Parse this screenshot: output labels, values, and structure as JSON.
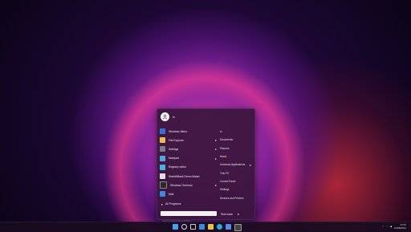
{
  "start_menu": {
    "user_name": "ic",
    "apps": [
      {
        "label": "Windows Menu",
        "icon": "windows-menu-icon",
        "color": "#3a6fd8",
        "submenu": false
      },
      {
        "label": "File Explorer",
        "icon": "file-explorer-icon",
        "color": "#e8c04a",
        "submenu": true
      },
      {
        "label": "Settings",
        "icon": "settings-icon",
        "color": "#7a7a8a",
        "submenu": true
      },
      {
        "label": "Notepad",
        "icon": "notepad-icon",
        "color": "#5aa0e0",
        "submenu": true
      },
      {
        "label": "Registry editor",
        "icon": "registry-icon",
        "color": "#4ab0d8",
        "submenu": false
      },
      {
        "label": "StartAllBack Demo Maker",
        "icon": "startallback-icon",
        "color": "#e0e0e0",
        "submenu": false
      },
      {
        "label": "Windows Terminal",
        "icon": "terminal-icon",
        "color": "#2a2a2a",
        "submenu": true
      },
      {
        "label": "Mail",
        "icon": "mail-icon",
        "color": "#3a8ae0",
        "submenu": false
      }
    ],
    "all_programs": "All Programs",
    "places": [
      {
        "label": "ic",
        "submenu": false
      },
      {
        "label": "Documents",
        "submenu": false
      },
      {
        "label": "Pictures",
        "submenu": false
      },
      {
        "label": "Music",
        "submenu": false
      },
      {
        "label": "Universal Applications",
        "submenu": true
      },
      {
        "label": "This PC",
        "submenu": false
      },
      {
        "label": "Control Panel",
        "submenu": false
      },
      {
        "label": "Settings",
        "submenu": false
      },
      {
        "label": "Devices and Printers",
        "submenu": false
      }
    ],
    "search_placeholder": "Search programs and files",
    "shutdown_label": "Shut down"
  },
  "taskbar": {
    "icons": [
      {
        "name": "start-icon",
        "color": "#4aa0f0"
      },
      {
        "name": "search-icon",
        "color": "#dddddd"
      },
      {
        "name": "task-view-icon",
        "color": "#cccccc"
      },
      {
        "name": "widgets-icon",
        "color": "#3a8ae0"
      },
      {
        "name": "file-explorer-icon",
        "color": "#e8c04a"
      },
      {
        "name": "edge-icon",
        "color": "#2aa8d8"
      },
      {
        "name": "store-icon",
        "color": "#5a8ae8"
      },
      {
        "name": "terminal-icon",
        "color": "#444444"
      }
    ],
    "time": "17:44",
    "date": "10/08/2021"
  }
}
